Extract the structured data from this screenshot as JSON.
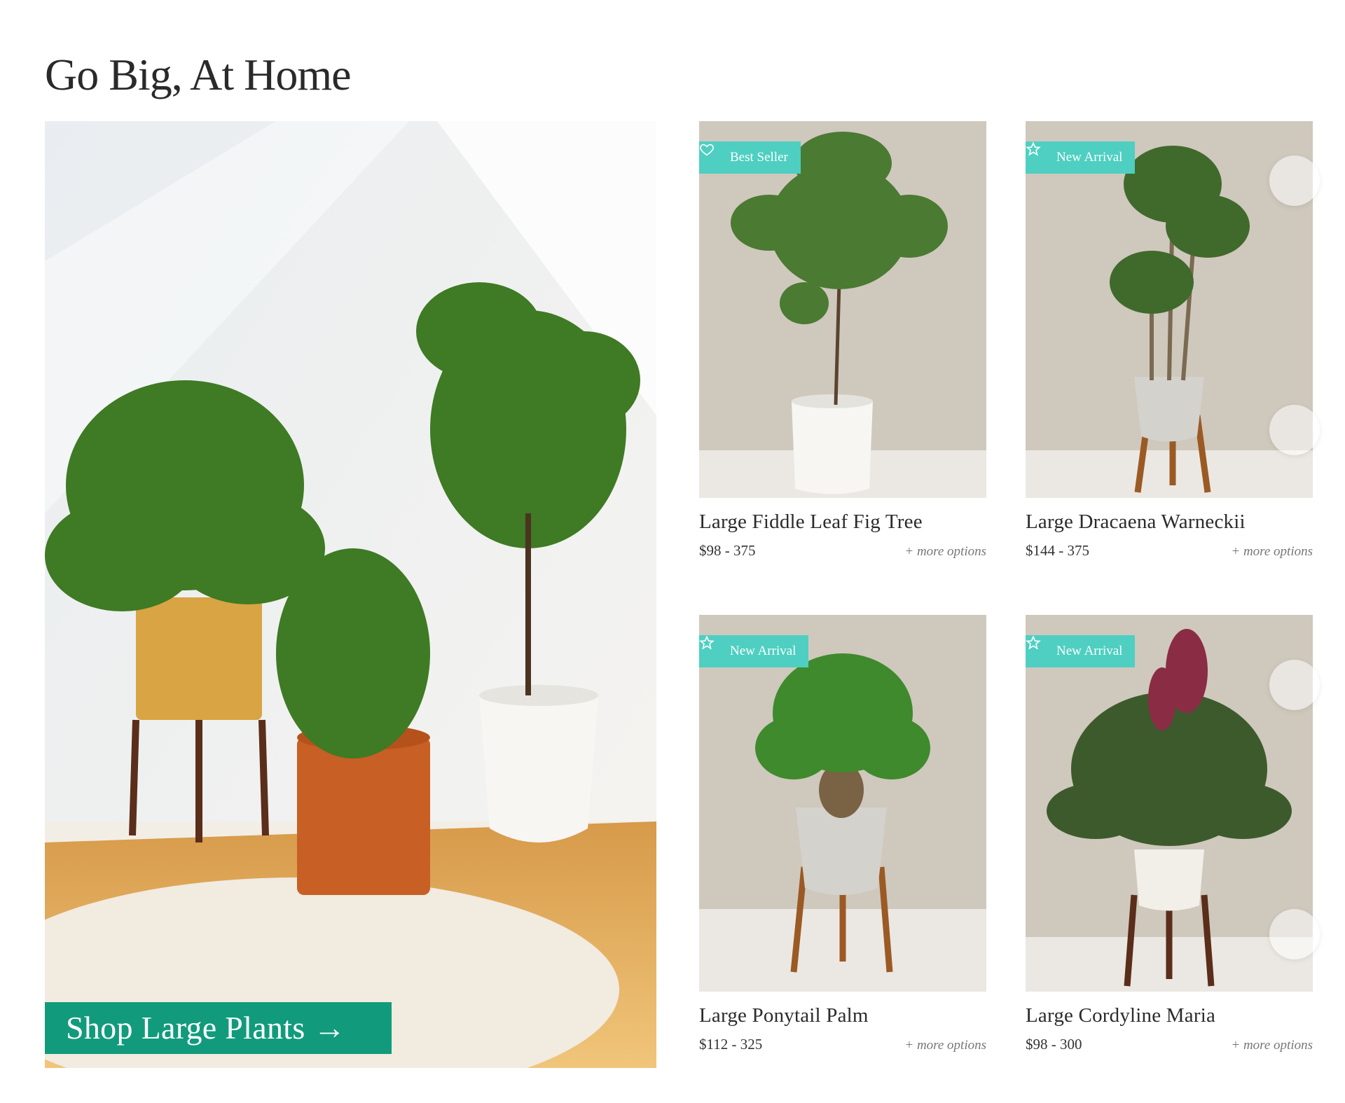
{
  "section": {
    "title": "Go Big, At Home"
  },
  "hero": {
    "cta_label": "Shop Large Plants →"
  },
  "products": [
    {
      "badge": "Best Seller",
      "badge_icon": "heart-icon",
      "name": "Large Fiddle Leaf Fig Tree",
      "price": "$98 - 375",
      "more": "+ more options"
    },
    {
      "badge": "New Arrival",
      "badge_icon": "star-icon",
      "name": "Large Dracaena Warneckii",
      "price": "$144 - 375",
      "more": "+ more options"
    },
    {
      "badge": "New Arrival",
      "badge_icon": "star-icon",
      "name": "Large Ponytail Palm",
      "price": "$112 - 325",
      "more": "+ more options"
    },
    {
      "badge": "New Arrival",
      "badge_icon": "star-icon",
      "name": "Large Cordyline Maria",
      "price": "$98 - 300",
      "more": "+ more options"
    }
  ],
  "colors": {
    "accent": "#119b7c",
    "badge": "#4ecfc1",
    "photo_bg": "#cfc8bd"
  }
}
